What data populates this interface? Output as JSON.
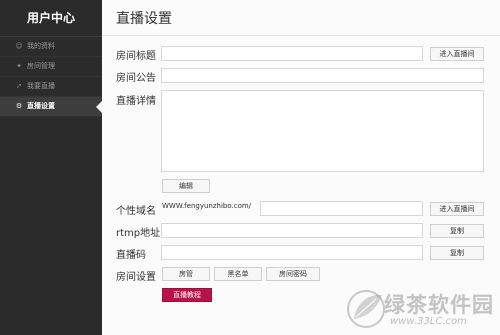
{
  "sidebar": {
    "title": "用户中心",
    "items": [
      {
        "icon": "user-icon",
        "label": "我的资料"
      },
      {
        "icon": "wrench-icon",
        "label": "房间管理"
      },
      {
        "icon": "pin-icon",
        "label": "我要直播"
      },
      {
        "icon": "gear-icon",
        "label": "直播设置"
      }
    ],
    "active_index": 3
  },
  "main": {
    "title": "直播设置",
    "room_title": {
      "label": "房间标题",
      "value": "",
      "button": "进入直播间"
    },
    "room_notice": {
      "label": "房间公告",
      "value": ""
    },
    "live_detail": {
      "label": "直播详情",
      "value": "",
      "edit_button": "编辑"
    },
    "custom_domain": {
      "label": "个性域名",
      "prefix": "WWW.fengyunzhibo.com/",
      "value": "",
      "button": "进入直播间"
    },
    "rtmp": {
      "label": "rtmp地址",
      "value": "",
      "button": "复制"
    },
    "live_code": {
      "label": "直播码",
      "value": "",
      "button": "复制"
    },
    "room_settings": {
      "label": "房间设置",
      "buttons": [
        "房管",
        "黑名单",
        "房间密码"
      ]
    },
    "tutorial_button": "直播教程"
  },
  "watermark": {
    "text": "绿茶软件园",
    "url": "www.33LC.com"
  },
  "colors": {
    "sidebar_bg": "#2b2b2b",
    "accent": "#b5134a",
    "content_bg": "#fbfbfb"
  }
}
